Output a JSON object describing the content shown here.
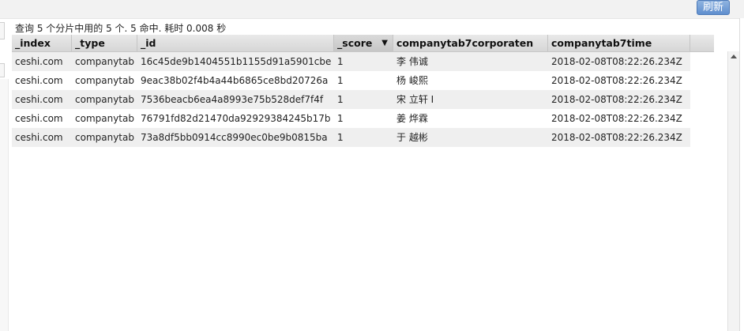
{
  "toolbar": {
    "refresh_label": "刷新"
  },
  "summary": "查询 5 个分片中用的 5 个. 5 命中. 耗时 0.008 秒",
  "columns": [
    {
      "label": "_index"
    },
    {
      "label": "_type"
    },
    {
      "label": "_id"
    },
    {
      "label": "_score",
      "sort_icon": "▼"
    },
    {
      "label": "companytab7corporaten"
    },
    {
      "label": "companytab7time"
    }
  ],
  "rows": [
    {
      "index": "ceshi.com",
      "type": "companytab",
      "id": "16c45de9b1404551b1155d91a5901cbe",
      "score": "1",
      "corp": "李 伟诚",
      "time": "2018-02-08T08:22:26.234Z"
    },
    {
      "index": "ceshi.com",
      "type": "companytab",
      "id": "9eac38b02f4b4a44b6865ce8bd20726a",
      "score": "1",
      "corp": "杨 峻熙",
      "time": "2018-02-08T08:22:26.234Z"
    },
    {
      "index": "ceshi.com",
      "type": "companytab",
      "id": "7536beacb6ea4a8993e75b528def7f4f",
      "score": "1",
      "corp": "宋 立轩 I",
      "time": "2018-02-08T08:22:26.234Z"
    },
    {
      "index": "ceshi.com",
      "type": "companytab",
      "id": "76791fd82d21470da92929384245b17b",
      "score": "1",
      "corp": "姜 烨霖",
      "time": "2018-02-08T08:22:26.234Z"
    },
    {
      "index": "ceshi.com",
      "type": "companytab",
      "id": "73a8df5bb0914cc8990ec0be9b0815ba",
      "score": "1",
      "corp": "于 越彬",
      "time": "2018-02-08T08:22:26.234Z"
    }
  ]
}
